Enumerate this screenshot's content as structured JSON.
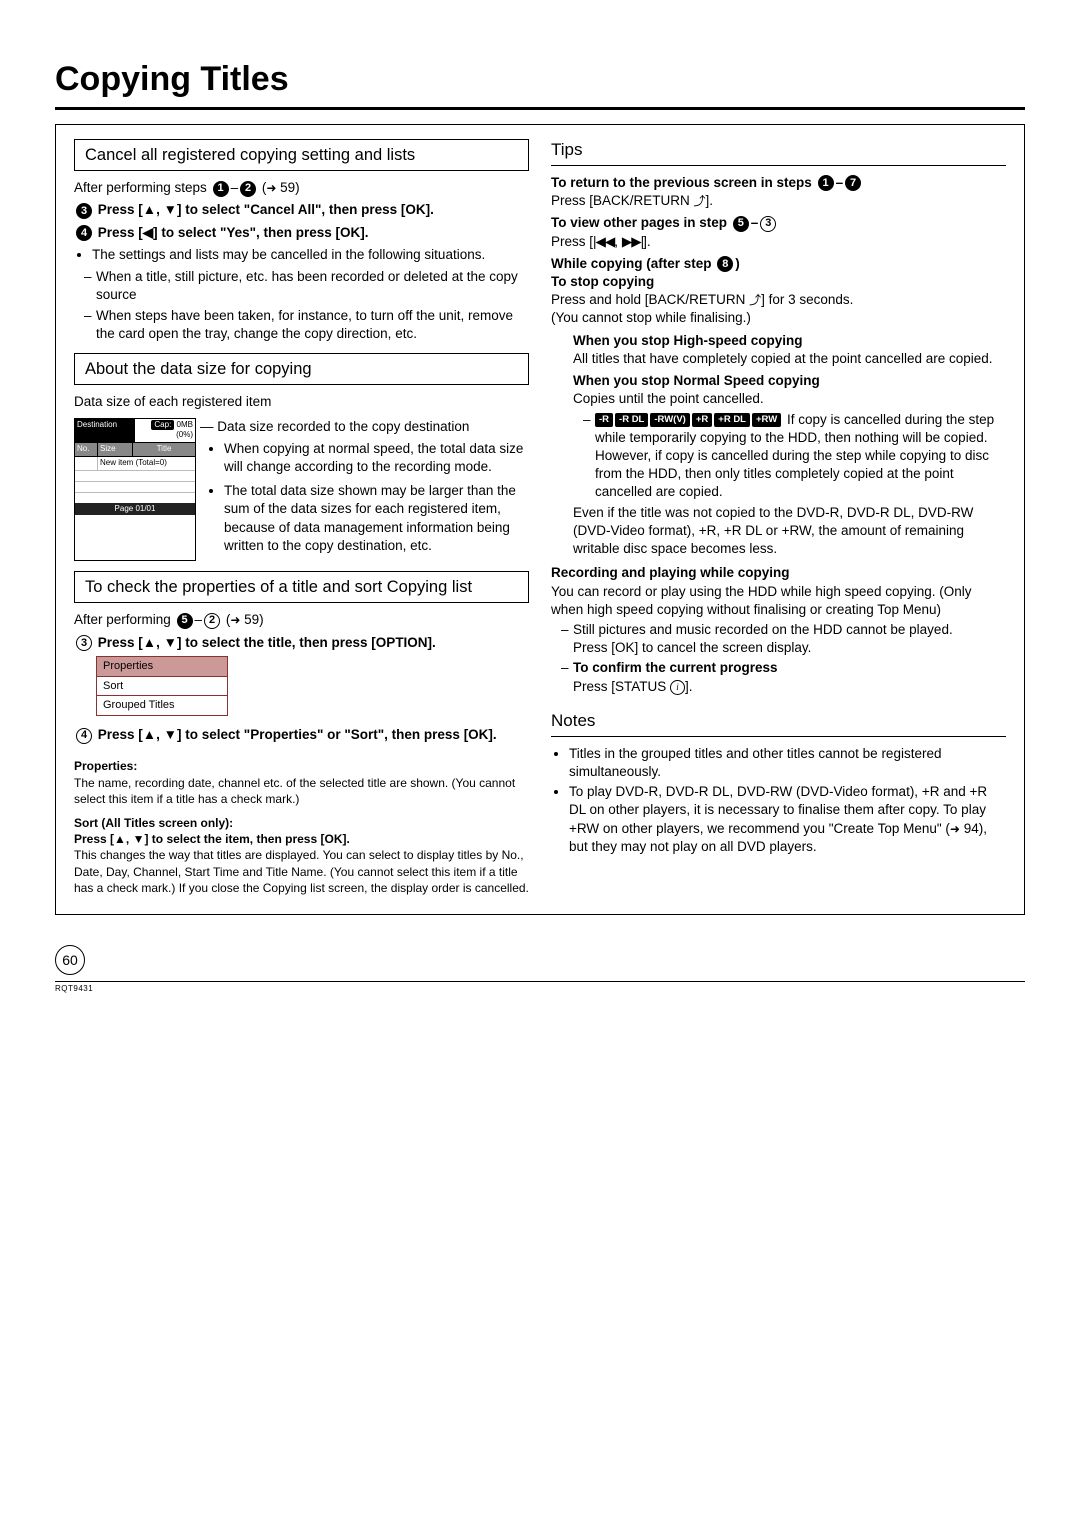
{
  "title": "Copying Titles",
  "section_cancel": "Cancel all registered copying setting and lists",
  "cancel_after": "After performing steps ",
  "cancel_ref": " 59)",
  "cancel_step3": "Press [▲, ▼] to select \"Cancel All\", then press [OK].",
  "cancel_step4": "Press [◀] to select \"Yes\", then press [OK].",
  "cancel_note": "The settings and lists may be cancelled in the following situations.",
  "cancel_dash1": "When a title, still picture, etc. has been recorded or deleted at the copy source",
  "cancel_dash2": "When steps have been taken, for instance, to turn off the unit, remove the card open the tray, change the copy direction, etc.",
  "section_datasize": "About the data size for copying",
  "ds_intro": "Data size of each registered item",
  "ds_box": {
    "dest": "Destination",
    "cap": "Cap:",
    "capval": "0MB (0%)",
    "no": "No.",
    "size": "Size",
    "title": "Title",
    "newitem": "New item (Total=0)",
    "footer": "Page 01/01"
  },
  "ds_pointer": "Data size recorded to the copy destination",
  "ds_b1": "When copying at normal speed, the total data size will change according to the recording mode.",
  "ds_b2": "The total data size shown may be larger than the sum of the data sizes for each registered item, because of data management information being written to the copy destination, etc.",
  "section_check": "To check the properties of a title and sort Copying list",
  "check_after": "After performing ",
  "check_step3": "Press [▲, ▼] to select the title, then press [OPTION].",
  "menu_props": "Properties",
  "menu_sort": "Sort",
  "menu_grp": "Grouped Titles",
  "check_step4": "Press [▲, ▼] to select \"Properties\" or \"Sort\", then press [OK].",
  "props_head": "Properties:",
  "props_body": "The name, recording date, channel etc. of the selected title are shown. (You cannot select this item if a title has a check mark.)",
  "sort_head": "Sort (All Titles screen only):",
  "sort_sub": "Press [▲, ▼] to select the item, then press [OK].",
  "sort_body": "This changes the way that titles are displayed. You can select to display titles by No., Date, Day, Channel, Start Time and Title Name. (You cannot select this item if a title has a check mark.) If you close the Copying list screen, the display order is cancelled.",
  "tips_header": "Tips",
  "tips_return": "To return to the previous screen in steps ",
  "tips_return_body": "Press [BACK/RETURN ].",
  "tips_view": "To view other pages in step ",
  "tips_view_body": "Press [ , ].",
  "tips_while": "While copying (after step )",
  "tips_stop_h": "To stop copying",
  "tips_stop_body1": "Press and hold [BACK/RETURN ] for 3 seconds.",
  "tips_stop_body2": "(You cannot stop while finalising.)",
  "tips_hs_h": "When you stop High-speed copying",
  "tips_hs_body": "All titles that have completely copied at the point cancelled are copied.",
  "tips_ns_h": "When you stop Normal Speed copying",
  "tips_ns_body": "Copies until the point cancelled.",
  "tips_ns_list": "If copy is cancelled during the step while temporarily copying to the HDD, then nothing will be copied. However, if copy is cancelled during the step while copying to disc from the HDD, then only titles completely copied at the point cancelled are copied.",
  "badges": [
    "-R",
    "-R DL",
    "-RW(V)",
    "+R",
    "+R DL",
    "+RW"
  ],
  "tips_even": "Even if the title was not copied to the DVD-R, DVD-R DL, DVD-RW (DVD-Video format), +R, +R DL or +RW, the amount of remaining writable disc space becomes less.",
  "tips_rec_h": "Recording and playing while copying",
  "tips_rec_body": "You can record or play using the HDD while high speed copying. (Only when high speed copying without finalising or creating Top Menu)",
  "tips_rec_d1": "Still pictures and music recorded on the HDD cannot be played.",
  "tips_rec_d1b": "Press [OK] to cancel the screen display.",
  "tips_rec_d2h": "To confirm the current progress",
  "tips_rec_d2b": "Press [STATUS ].",
  "notes_header": "Notes",
  "note1": "Titles in the grouped titles and other titles cannot be registered simultaneously.",
  "note2a": "To play DVD-R, DVD-R DL, DVD-RW (DVD-Video format), +R and +R DL on other players, it is necessary to finalise them after copy. To play +RW on other players, we recommend you \"",
  "note2mid": "Create Top Menu",
  "note2ref": " 94), but they may not play on all DVD players.",
  "page_num": "60",
  "doc_id": "RQT9431"
}
